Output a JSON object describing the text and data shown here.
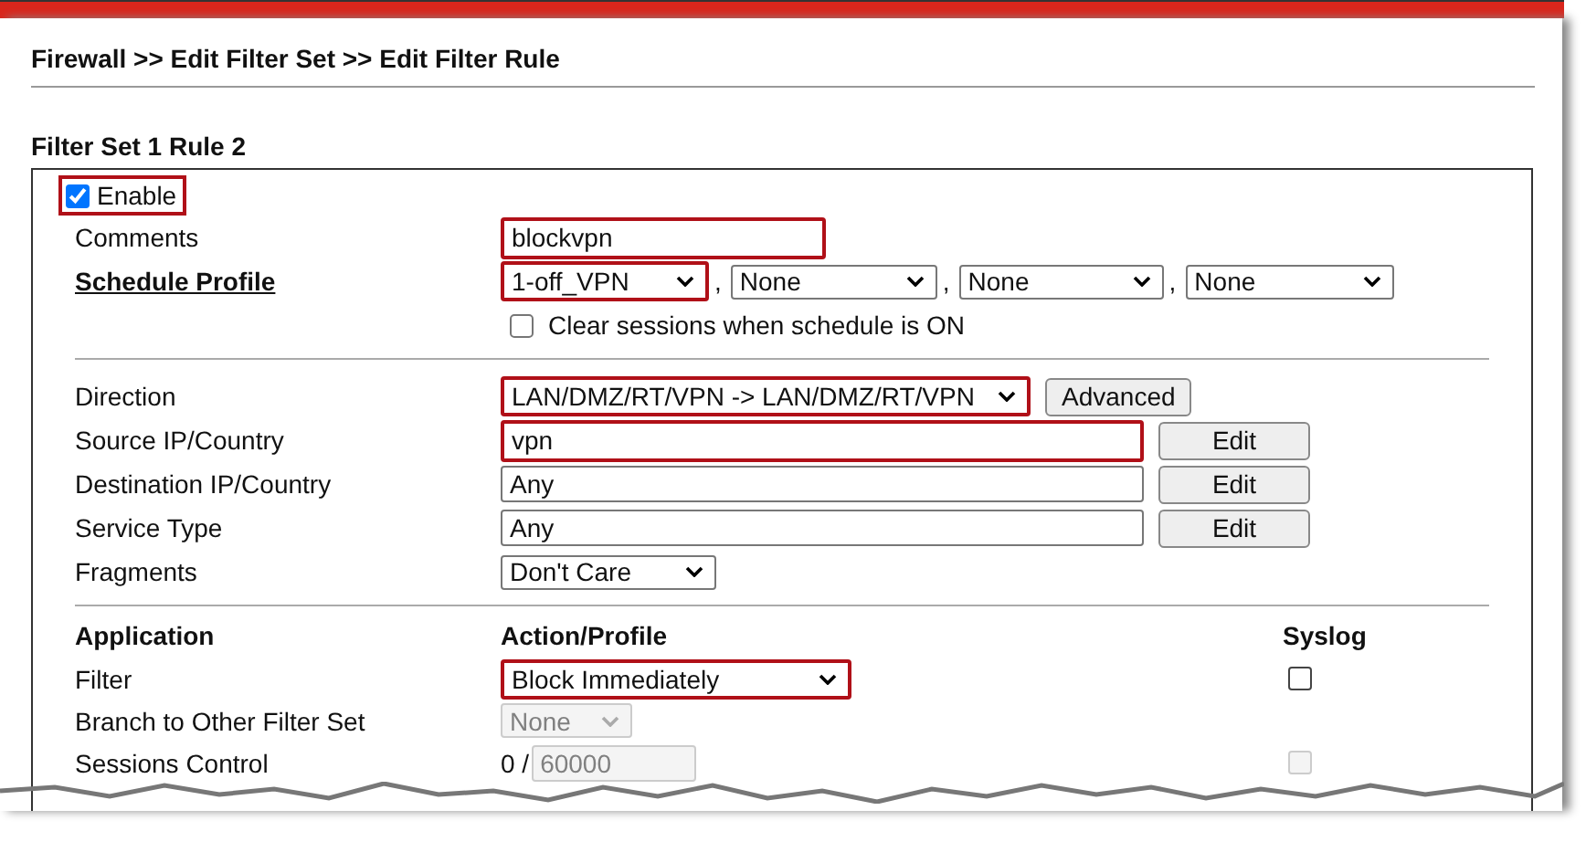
{
  "breadcrumb": "Firewall >> Edit Filter Set >> Edit Filter Rule",
  "section_title": "Filter Set 1 Rule 2",
  "enable": {
    "label": "Enable",
    "checked": true,
    "highlighted": true
  },
  "comments": {
    "label": "Comments",
    "value": "blockvpn",
    "highlighted": true
  },
  "schedule": {
    "label": "Schedule Profile",
    "separator": ",",
    "selects": [
      {
        "value": "1-off_VPN",
        "highlighted": true
      },
      {
        "value": "None",
        "highlighted": false
      },
      {
        "value": "None",
        "highlighted": false
      },
      {
        "value": "None",
        "highlighted": false
      }
    ],
    "clear_sessions": {
      "label": "Clear sessions when schedule is ON",
      "checked": false
    }
  },
  "rules": [
    {
      "kind": "select",
      "label": "Direction",
      "value": "LAN/DMZ/RT/VPN -> LAN/DMZ/RT/VPN",
      "highlighted": true,
      "button": "Advanced"
    },
    {
      "kind": "input",
      "label": "Source IP/Country",
      "value": "vpn",
      "highlighted": true,
      "button": "Edit"
    },
    {
      "kind": "input",
      "label": "Destination IP/Country",
      "value": "Any",
      "highlighted": false,
      "button": "Edit"
    },
    {
      "kind": "input",
      "label": "Service Type",
      "value": "Any",
      "highlighted": false,
      "button": "Edit"
    },
    {
      "kind": "small-select",
      "label": "Fragments",
      "value": "Don't Care",
      "highlighted": false
    }
  ],
  "application": {
    "headers": [
      "Application",
      "Action/Profile",
      "Syslog"
    ],
    "rows": [
      {
        "kind": "select",
        "label": "Filter",
        "value": "Block Immediately",
        "highlighted": true,
        "disabled": false,
        "syslog": {
          "checked": false,
          "disabled": false
        }
      },
      {
        "kind": "select",
        "label": "Branch to Other Filter Set",
        "value": "None",
        "highlighted": false,
        "disabled": true
      },
      {
        "kind": "session",
        "label": "Sessions Control",
        "prefix": "0 /",
        "value": "60000",
        "disabled": true,
        "syslog": {
          "checked": false,
          "disabled": true
        }
      }
    ]
  }
}
